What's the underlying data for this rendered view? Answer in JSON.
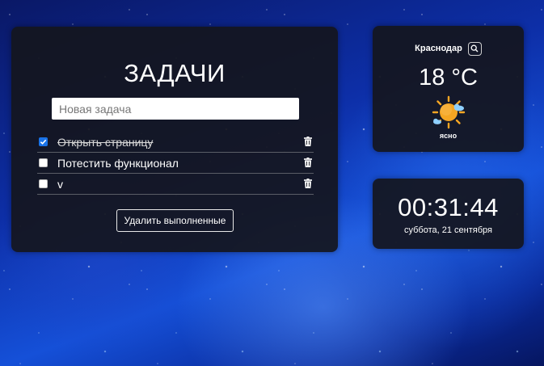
{
  "tasks": {
    "title": "ЗАДАЧИ",
    "new_task_placeholder": "Новая задача",
    "items": [
      {
        "text": "Открыть страницу",
        "done": true
      },
      {
        "text": "Потестить функционал",
        "done": false
      },
      {
        "text": "v",
        "done": false
      }
    ],
    "clear_label": "Удалить выполненные"
  },
  "weather": {
    "city": "Краснодар",
    "temperature": "18 °C",
    "condition": "ясно",
    "icon": "sun-cloud-icon"
  },
  "clock": {
    "time": "00:31:44",
    "date": "суббота, 21 сентября"
  },
  "colors": {
    "panel_bg": "#14161e",
    "checkbox_checked": "#1a73e8",
    "sun": "#f5a623",
    "cloud": "#8fd0ff"
  }
}
